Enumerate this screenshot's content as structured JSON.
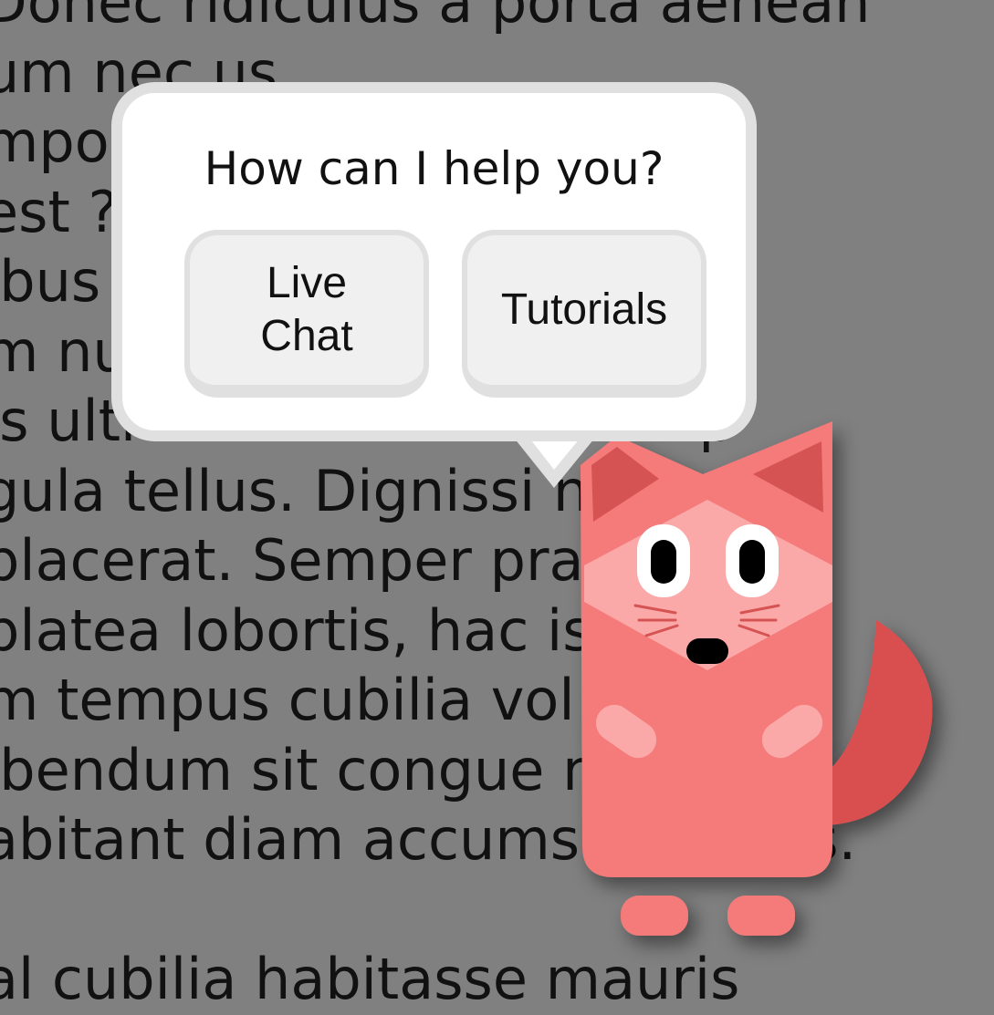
{
  "background_lines": [
    "  Donec ridiculus a porta aenean",
    "  um nec                                                        us",
    "  mpor                                                          gravida",
    "  est                                                            ? Fusce",
    "  ibus                                                         osum",
    "  m nu                                                         nodo",
    "  is ultrices! Elit netus semp",
    "  gula tellus. Dignissi                       n leo",
    "  placerat. Semper pra                       t",
    "  platea lobortis, hac                        is",
    "  m tempus cubilia vol",
    "  ibendum sit congue                          nisl",
    "  abitant diam accumsan luctus.",
    "",
    "  al cubilia habitasse mauris"
  ],
  "helper": {
    "title": "How can I help you?",
    "buttons": {
      "live_chat": "Live Chat",
      "tutorials": "Tutorials"
    }
  },
  "mascot": {
    "icon": "fox-mascot-icon",
    "colors": {
      "body": "#f57a7a",
      "ear_inner": "#d65353",
      "face": "#fba8a8",
      "tail": "#d95050"
    }
  }
}
